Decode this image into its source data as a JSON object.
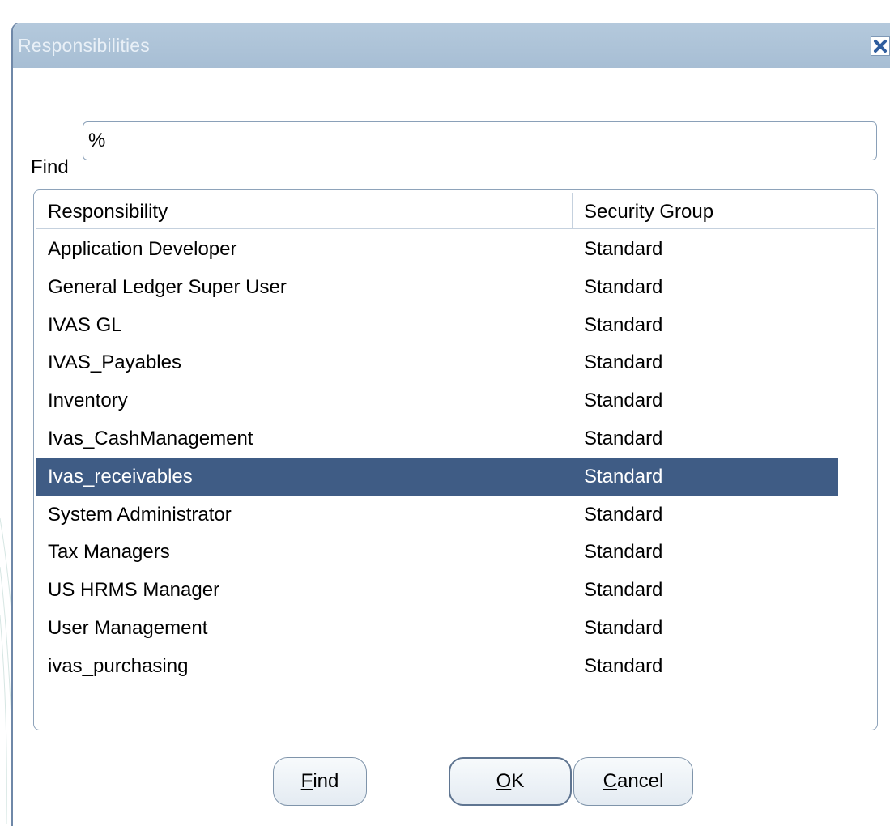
{
  "window": {
    "title": "Responsibilities"
  },
  "search": {
    "label": "Find",
    "value": "%"
  },
  "table": {
    "columns": [
      "Responsibility",
      "Security Group"
    ],
    "rows": [
      {
        "responsibility": "Application Developer",
        "security_group": "Standard"
      },
      {
        "responsibility": "General Ledger Super User",
        "security_group": "Standard"
      },
      {
        "responsibility": "IVAS GL",
        "security_group": "Standard"
      },
      {
        "responsibility": "IVAS_Payables",
        "security_group": "Standard"
      },
      {
        "responsibility": "Inventory",
        "security_group": "Standard"
      },
      {
        "responsibility": "Ivas_CashManagement",
        "security_group": "Standard"
      },
      {
        "responsibility": "Ivas_receivables",
        "security_group": "Standard",
        "selected": true
      },
      {
        "responsibility": "System Administrator",
        "security_group": "Standard"
      },
      {
        "responsibility": "Tax Managers",
        "security_group": "Standard"
      },
      {
        "responsibility": "US HRMS Manager",
        "security_group": "Standard"
      },
      {
        "responsibility": "User Management",
        "security_group": "Standard"
      },
      {
        "responsibility": "ivas_purchasing",
        "security_group": "Standard"
      }
    ]
  },
  "buttons": {
    "find": {
      "mnemonic": "F",
      "rest": "ind"
    },
    "ok": {
      "mnemonic": "O",
      "rest": "K"
    },
    "cancel": {
      "mnemonic": "C",
      "rest": "ancel"
    }
  },
  "colors": {
    "titlebar": "#a7bed4",
    "selection": "#3f5c85",
    "border": "#8ea3ba"
  },
  "icons": {
    "close": "close-icon"
  }
}
